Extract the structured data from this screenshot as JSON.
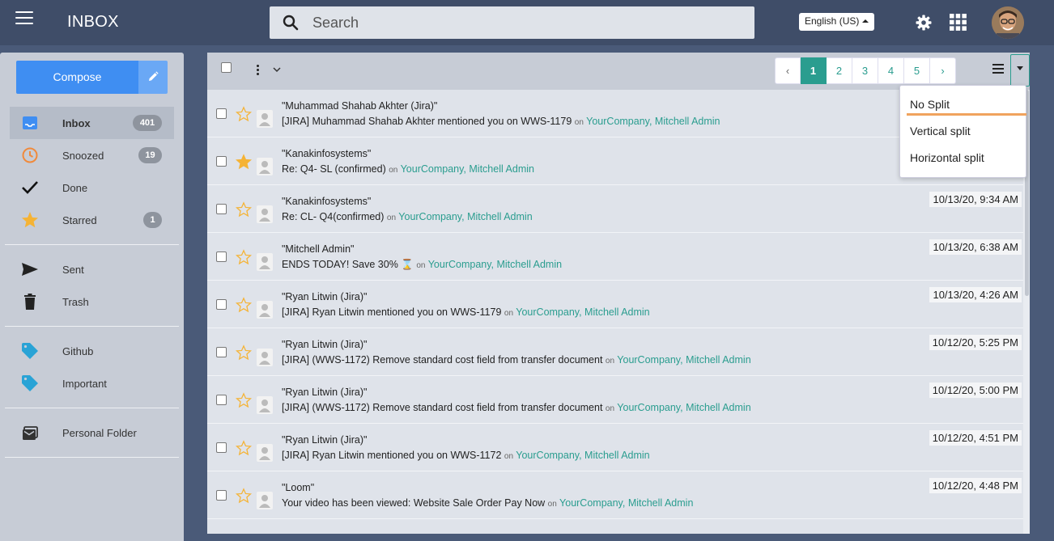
{
  "header": {
    "title": "INBOX",
    "search_placeholder": "Search",
    "language": "English (US)"
  },
  "sidebar": {
    "compose_label": "Compose",
    "items": [
      {
        "label": "Inbox",
        "badge": "401",
        "icon": "inbox-icon",
        "active": true
      },
      {
        "label": "Snoozed",
        "badge": "19",
        "icon": "clock-icon"
      },
      {
        "label": "Done",
        "icon": "checkmark-icon"
      },
      {
        "label": "Starred",
        "badge": "1",
        "icon": "star-icon"
      },
      {
        "label": "Sent",
        "icon": "send-icon"
      },
      {
        "label": "Trash",
        "icon": "trash-icon"
      },
      {
        "label": "Github",
        "icon": "tag-icon"
      },
      {
        "label": "Important",
        "icon": "tag-icon"
      },
      {
        "label": "Personal Folder",
        "icon": "folder-icon"
      }
    ]
  },
  "pager": {
    "prev": "‹",
    "pages": [
      "1",
      "2",
      "3",
      "4",
      "5"
    ],
    "current": "1",
    "next": "›"
  },
  "split_menu": {
    "items": [
      "No Split",
      "Vertical split",
      "Horizontal split"
    ],
    "selected": "No Split"
  },
  "messages": [
    {
      "sender": "\"Muhammad Shahab Akhter (Jira)\"",
      "subject": "[JIRA] Muhammad Shahab Akhter mentioned you on WWS-1179",
      "on": "on",
      "org": "YourCompany, Mitchell Admin",
      "date": "",
      "starred": false
    },
    {
      "sender": "\"Kanakinfosystems\"",
      "subject": "Re: Q4- SL (confirmed)",
      "on": "on",
      "org": "YourCompany, Mitchell Admin",
      "date": "",
      "starred": true
    },
    {
      "sender": "\"Kanakinfosystems\"",
      "subject": "Re: CL- Q4(confirmed)",
      "on": "on",
      "org": "YourCompany, Mitchell Admin",
      "date": "10/13/20, 9:34 AM",
      "starred": false
    },
    {
      "sender": "\"Mitchell Admin\"",
      "subject": "ENDS TODAY! Save 30% ⌛",
      "on": "on",
      "org": "YourCompany, Mitchell Admin",
      "date": "10/13/20, 6:38 AM",
      "starred": false
    },
    {
      "sender": "\"Ryan Litwin (Jira)\"",
      "subject": "[JIRA] Ryan Litwin mentioned you on WWS-1179",
      "on": "on",
      "org": "YourCompany, Mitchell Admin",
      "date": "10/13/20, 4:26 AM",
      "starred": false
    },
    {
      "sender": "\"Ryan Litwin (Jira)\"",
      "subject": "[JIRA] (WWS-1172) Remove standard cost field from transfer document",
      "on": "on",
      "org": "YourCompany, Mitchell Admin",
      "date": "10/12/20, 5:25 PM",
      "starred": false
    },
    {
      "sender": "\"Ryan Litwin (Jira)\"",
      "subject": "[JIRA] (WWS-1172) Remove standard cost field from transfer document",
      "on": "on",
      "org": "YourCompany, Mitchell Admin",
      "date": "10/12/20, 5:00 PM",
      "starred": false
    },
    {
      "sender": "\"Ryan Litwin (Jira)\"",
      "subject": "[JIRA] Ryan Litwin mentioned you on WWS-1172",
      "on": "on",
      "org": "YourCompany, Mitchell Admin",
      "date": "10/12/20, 4:51 PM",
      "starred": false
    },
    {
      "sender": "\"Loom\"",
      "subject": "Your video has been viewed: Website Sale Order Pay Now",
      "on": "on",
      "org": "YourCompany, Mitchell Admin",
      "date": "10/12/20, 4:48 PM",
      "starred": false
    }
  ],
  "colors": {
    "accent": "#2a9d8f",
    "compose": "#3f8ef2",
    "star": "#f5b335",
    "topbar": "#3f4d68"
  }
}
